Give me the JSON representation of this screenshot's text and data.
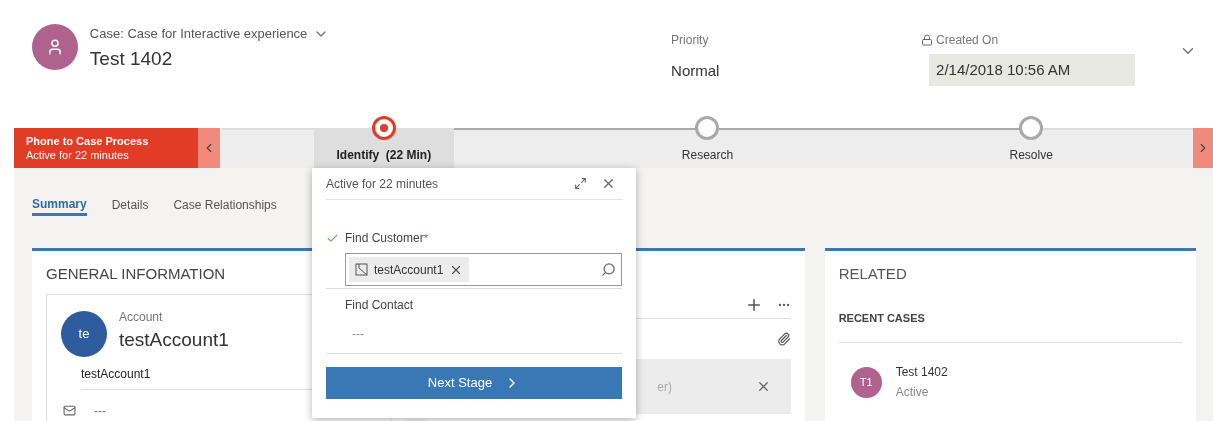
{
  "header": {
    "entity_label": "Case: Case for Interactive experience",
    "title": "Test 1402",
    "fields": [
      {
        "label": "Priority",
        "value": "Normal",
        "locked": false
      },
      {
        "label": "Created On",
        "value": "2/14/2018 10:56 AM",
        "locked": true
      }
    ]
  },
  "process": {
    "name": "Phone to Case Process",
    "status": "Active for 22 minutes",
    "stages": [
      {
        "label": "Identify  (22 Min)",
        "selected": true
      },
      {
        "label": "Research",
        "selected": false
      },
      {
        "label": "Resolve",
        "selected": false
      }
    ]
  },
  "tabs": [
    {
      "label": "Summary",
      "selected": true
    },
    {
      "label": "Details",
      "selected": false
    },
    {
      "label": "Case Relationships",
      "selected": false
    }
  ],
  "general_information": {
    "title": "GENERAL INFORMATION",
    "account": {
      "initials": "te",
      "type": "Account",
      "name": "testAccount1"
    },
    "account_line": "testAccount1",
    "email": "---"
  },
  "timeline": {
    "field_text": "er)"
  },
  "related": {
    "title": "RELATED",
    "section": "RECENT CASES",
    "cases": [
      {
        "initials": "T1",
        "title": "Test 1402",
        "status": "Active",
        "color": "#b0628e"
      }
    ]
  },
  "stage_popup": {
    "status": "Active for 22 minutes",
    "fields": [
      {
        "kind": "lookup",
        "label": "Find Customer",
        "required_mark": "*",
        "completed": true,
        "value": "testAccount1"
      },
      {
        "kind": "text",
        "label": "Find Contact",
        "completed": false,
        "value": "---"
      }
    ],
    "button": "Next Stage"
  }
}
